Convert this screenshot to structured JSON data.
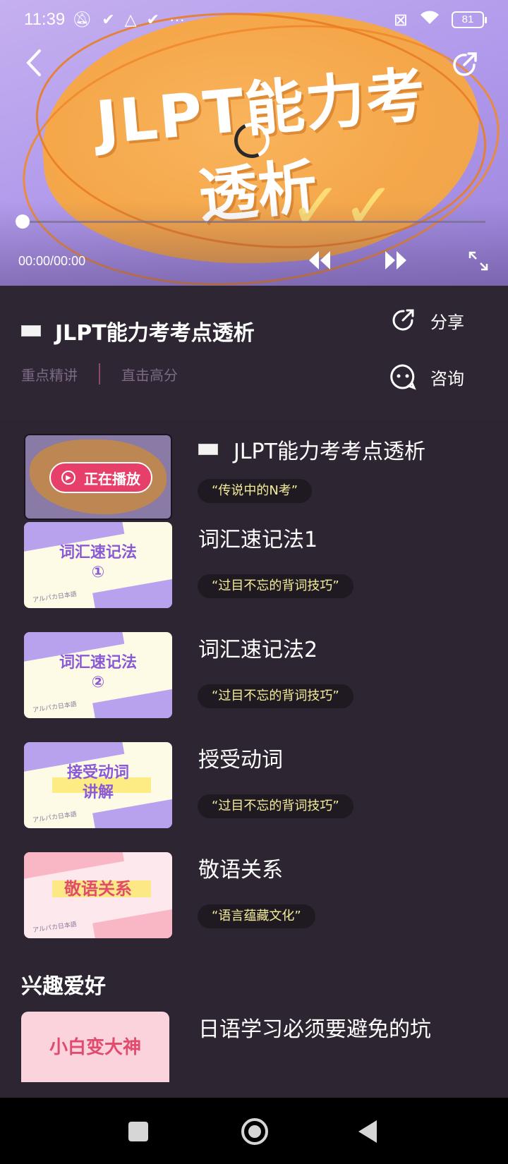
{
  "status_bar": {
    "time": "11:39",
    "left_icons": [
      "mute-icon",
      "check-icon",
      "drive-icon",
      "check-icon",
      "more-dots-icon"
    ],
    "more": "···",
    "battery": "81"
  },
  "player": {
    "title_line1": "JLPT能力考",
    "title_line2": "透析",
    "time_readout": "00:00/00:00",
    "progress": 0,
    "loading": true
  },
  "info": {
    "course_title": "JLPT能力考考点透析",
    "tags": [
      "重点精讲",
      "直击高分"
    ],
    "share_label": "分享",
    "consult_label": "咨询"
  },
  "lessons": [
    {
      "title": "JLPT能力考考点透析",
      "badge": "“传说中的N考”",
      "now_playing": true,
      "now_playing_label": "正在播放"
    },
    {
      "title": "词汇速记法1",
      "badge": "“过目不忘的背词技巧”",
      "thumb_text_1": "词汇速记法",
      "thumb_text_2": "①",
      "thumb_brand": "アルパカ日本語"
    },
    {
      "title": "词汇速记法2",
      "badge": "“过目不忘的背词技巧”",
      "thumb_text_1": "词汇速记法",
      "thumb_text_2": "②",
      "thumb_brand": "アルパカ日本語"
    },
    {
      "title": "授受动词",
      "badge": "“过目不忘的背词技巧”",
      "thumb_text_1": "接受动词",
      "thumb_text_2": "讲解",
      "thumb_brand": "アルパカ日本語"
    },
    {
      "title": "敬语关系",
      "badge": "“语言蕴藏文化”",
      "thumb_text_1": "敬语关系",
      "thumb_text_2": "",
      "thumb_brand": "アルパカ日本語"
    }
  ],
  "section": {
    "title": "兴趣爱好",
    "first_item_title": "日语学习必须要避免的坑",
    "first_item_thumb_text": "小白变大神"
  },
  "colors": {
    "background": "#2d2532",
    "badge_text": "#f5ec9a",
    "accent_pink": "#e6406a",
    "tag_text": "#7b6a86"
  }
}
